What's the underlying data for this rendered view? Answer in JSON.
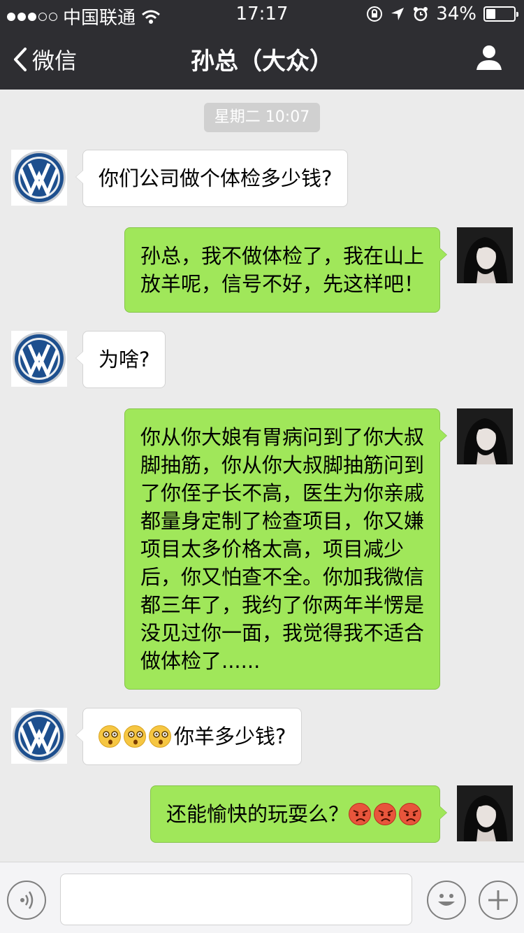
{
  "status_bar": {
    "carrier": "中国联通",
    "time": "17:17",
    "battery": "34%",
    "battery_level": 0.34
  },
  "nav": {
    "back_label": "微信",
    "title": "孙总（大众）"
  },
  "chat": {
    "timestamp": "星期二 10:07",
    "messages": [
      {
        "side": "in",
        "lines": [
          "你们公司做个体检多少钱?"
        ]
      },
      {
        "side": "out",
        "lines": [
          "孙总，我不做体检了，我在山上",
          "放羊呢，信号不好，先这样吧！"
        ]
      },
      {
        "side": "in",
        "lines": [
          "为啥?"
        ]
      },
      {
        "side": "out",
        "lines": [
          "你从你大娘有胃病问到了你大叔",
          "脚抽筋，你从你大叔脚抽筋问到",
          "了你侄子长不高，医生为你亲戚",
          "都量身定制了检查项目，你又嫌",
          "项目太多价格太高，项目减少",
          "后，你又怕查不全。你加我微信",
          "都三年了，我约了你两年半愣是",
          "没见过你一面，我觉得我不适合",
          "做体检了......"
        ]
      },
      {
        "side": "in",
        "text": "你羊多少钱?",
        "emojis": [
          "dizzy-face",
          "dizzy-face",
          "dizzy-face"
        ]
      },
      {
        "side": "out",
        "text": "还能愉快的玩耍么？",
        "emojis": [
          "angry-face",
          "angry-face",
          "angry-face"
        ]
      }
    ]
  },
  "colors": {
    "nav_bg": "#2e2e32",
    "chat_bg": "#ebebeb",
    "bubble_out": "#a0e75a",
    "bubble_in": "#ffffff"
  }
}
